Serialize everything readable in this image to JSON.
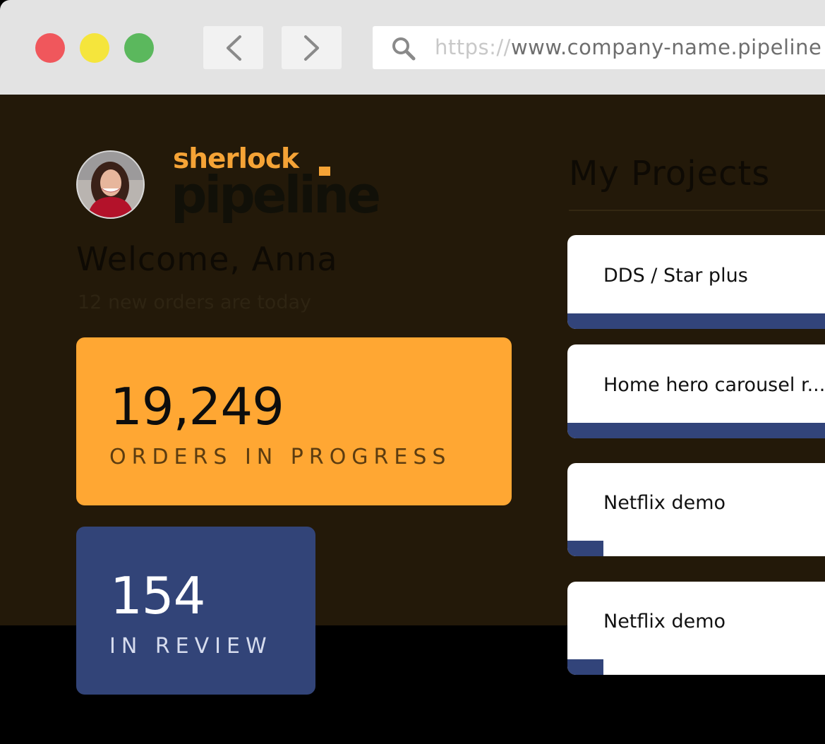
{
  "browser": {
    "url_scheme": "https://",
    "url_rest": "www.company-name.pipeline"
  },
  "brand": {
    "name_top": "sherlock",
    "name_bottom": "pipeline",
    "accent_color": "#f5a336"
  },
  "user": {
    "welcome": "Welcome, Anna",
    "subline": "12 new orders are today"
  },
  "stats": {
    "orders": {
      "value": "19,249",
      "label": "ORDERS IN PROGRESS",
      "color": "#ffa733"
    },
    "review": {
      "value": "154",
      "label": "IN REVIEW",
      "color": "#324478"
    }
  },
  "projects": {
    "title": "My Projects",
    "items": [
      {
        "name": "DDS / Star plus",
        "progress": 1.0
      },
      {
        "name": "Home hero carousel r...",
        "progress": 1.0
      },
      {
        "name": "Netflix demo",
        "progress": 0.14
      },
      {
        "name": "Netflix demo",
        "progress": 0.14
      }
    ]
  }
}
